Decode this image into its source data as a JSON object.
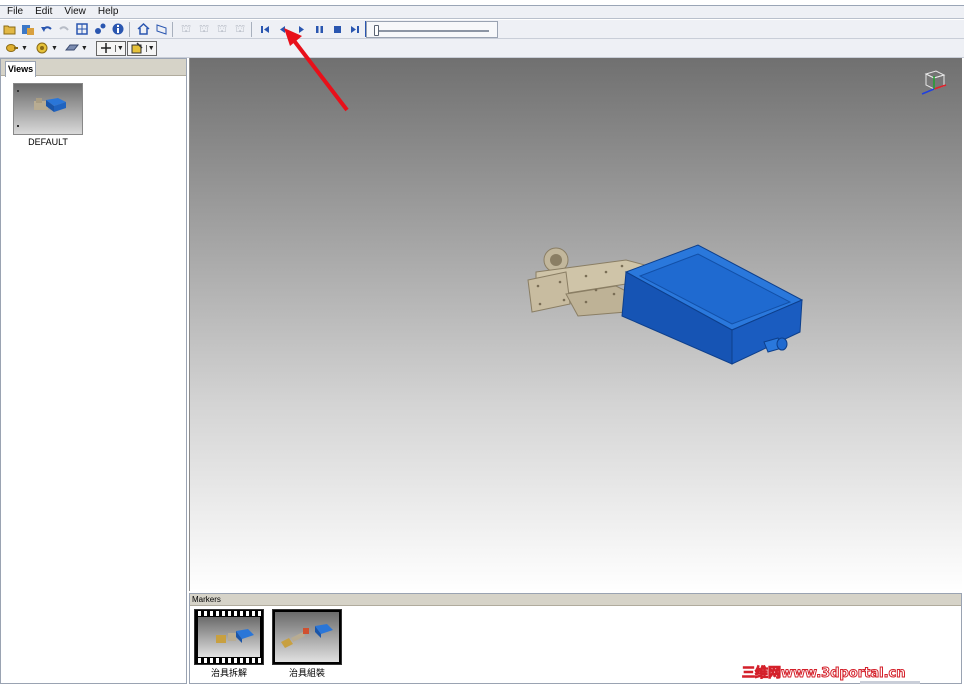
{
  "menu": {
    "items": [
      "File",
      "Edit",
      "View",
      "Help"
    ]
  },
  "toolbar1": {
    "icons": [
      "open-icon",
      "import-icon",
      "undo-icon",
      "redo-icon",
      "fit-all-icon",
      "explode-icon",
      "info-icon",
      "home-view-icon",
      "perspective-icon",
      "camera-1-icon",
      "camera-2-icon",
      "camera-3-icon",
      "camera-4-icon",
      "go-to-start-icon",
      "step-back-icon",
      "play-icon",
      "pause-icon",
      "stop-icon",
      "go-to-end-icon",
      "loop-icon"
    ],
    "timeline_position": 0.0
  },
  "toolbar2": {
    "icons": [
      "light-icon",
      "material-icon",
      "render-mode-icon",
      "pan-tool-icon",
      "select-tool-icon"
    ]
  },
  "views_panel": {
    "tab": "Views",
    "items": [
      {
        "label": "DEFAULT"
      }
    ]
  },
  "markers_panel": {
    "title": "Markers",
    "items": [
      {
        "label": "治具拆解"
      },
      {
        "label": "治具組裝"
      }
    ]
  },
  "watermark": "三维网www.3dportal.cn",
  "colors": {
    "model_blue": "#1a63c8",
    "model_metal": "#b8ac92",
    "arrow": "#e8101a"
  }
}
